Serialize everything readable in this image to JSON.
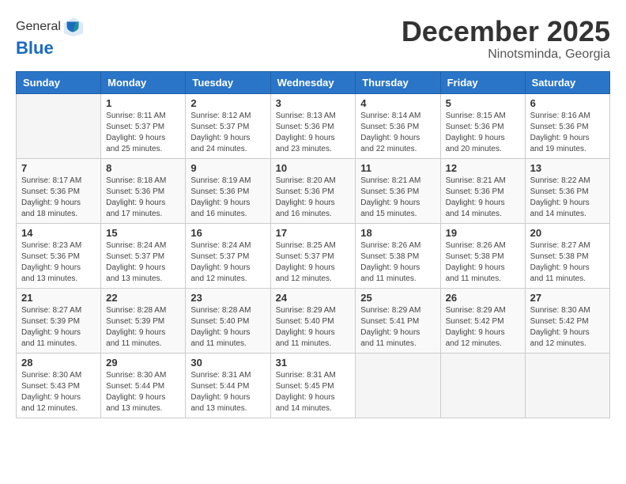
{
  "logo": {
    "general": "General",
    "blue": "Blue"
  },
  "header": {
    "month": "December 2025",
    "location": "Ninotsminda, Georgia"
  },
  "weekdays": [
    "Sunday",
    "Monday",
    "Tuesday",
    "Wednesday",
    "Thursday",
    "Friday",
    "Saturday"
  ],
  "weeks": [
    [
      {
        "day": "",
        "info": ""
      },
      {
        "day": "1",
        "info": "Sunrise: 8:11 AM\nSunset: 5:37 PM\nDaylight: 9 hours\nand 25 minutes."
      },
      {
        "day": "2",
        "info": "Sunrise: 8:12 AM\nSunset: 5:37 PM\nDaylight: 9 hours\nand 24 minutes."
      },
      {
        "day": "3",
        "info": "Sunrise: 8:13 AM\nSunset: 5:36 PM\nDaylight: 9 hours\nand 23 minutes."
      },
      {
        "day": "4",
        "info": "Sunrise: 8:14 AM\nSunset: 5:36 PM\nDaylight: 9 hours\nand 22 minutes."
      },
      {
        "day": "5",
        "info": "Sunrise: 8:15 AM\nSunset: 5:36 PM\nDaylight: 9 hours\nand 20 minutes."
      },
      {
        "day": "6",
        "info": "Sunrise: 8:16 AM\nSunset: 5:36 PM\nDaylight: 9 hours\nand 19 minutes."
      }
    ],
    [
      {
        "day": "7",
        "info": "Sunrise: 8:17 AM\nSunset: 5:36 PM\nDaylight: 9 hours\nand 18 minutes."
      },
      {
        "day": "8",
        "info": "Sunrise: 8:18 AM\nSunset: 5:36 PM\nDaylight: 9 hours\nand 17 minutes."
      },
      {
        "day": "9",
        "info": "Sunrise: 8:19 AM\nSunset: 5:36 PM\nDaylight: 9 hours\nand 16 minutes."
      },
      {
        "day": "10",
        "info": "Sunrise: 8:20 AM\nSunset: 5:36 PM\nDaylight: 9 hours\nand 16 minutes."
      },
      {
        "day": "11",
        "info": "Sunrise: 8:21 AM\nSunset: 5:36 PM\nDaylight: 9 hours\nand 15 minutes."
      },
      {
        "day": "12",
        "info": "Sunrise: 8:21 AM\nSunset: 5:36 PM\nDaylight: 9 hours\nand 14 minutes."
      },
      {
        "day": "13",
        "info": "Sunrise: 8:22 AM\nSunset: 5:36 PM\nDaylight: 9 hours\nand 14 minutes."
      }
    ],
    [
      {
        "day": "14",
        "info": "Sunrise: 8:23 AM\nSunset: 5:36 PM\nDaylight: 9 hours\nand 13 minutes."
      },
      {
        "day": "15",
        "info": "Sunrise: 8:24 AM\nSunset: 5:37 PM\nDaylight: 9 hours\nand 13 minutes."
      },
      {
        "day": "16",
        "info": "Sunrise: 8:24 AM\nSunset: 5:37 PM\nDaylight: 9 hours\nand 12 minutes."
      },
      {
        "day": "17",
        "info": "Sunrise: 8:25 AM\nSunset: 5:37 PM\nDaylight: 9 hours\nand 12 minutes."
      },
      {
        "day": "18",
        "info": "Sunrise: 8:26 AM\nSunset: 5:38 PM\nDaylight: 9 hours\nand 11 minutes."
      },
      {
        "day": "19",
        "info": "Sunrise: 8:26 AM\nSunset: 5:38 PM\nDaylight: 9 hours\nand 11 minutes."
      },
      {
        "day": "20",
        "info": "Sunrise: 8:27 AM\nSunset: 5:38 PM\nDaylight: 9 hours\nand 11 minutes."
      }
    ],
    [
      {
        "day": "21",
        "info": "Sunrise: 8:27 AM\nSunset: 5:39 PM\nDaylight: 9 hours\nand 11 minutes."
      },
      {
        "day": "22",
        "info": "Sunrise: 8:28 AM\nSunset: 5:39 PM\nDaylight: 9 hours\nand 11 minutes."
      },
      {
        "day": "23",
        "info": "Sunrise: 8:28 AM\nSunset: 5:40 PM\nDaylight: 9 hours\nand 11 minutes."
      },
      {
        "day": "24",
        "info": "Sunrise: 8:29 AM\nSunset: 5:40 PM\nDaylight: 9 hours\nand 11 minutes."
      },
      {
        "day": "25",
        "info": "Sunrise: 8:29 AM\nSunset: 5:41 PM\nDaylight: 9 hours\nand 11 minutes."
      },
      {
        "day": "26",
        "info": "Sunrise: 8:29 AM\nSunset: 5:42 PM\nDaylight: 9 hours\nand 12 minutes."
      },
      {
        "day": "27",
        "info": "Sunrise: 8:30 AM\nSunset: 5:42 PM\nDaylight: 9 hours\nand 12 minutes."
      }
    ],
    [
      {
        "day": "28",
        "info": "Sunrise: 8:30 AM\nSunset: 5:43 PM\nDaylight: 9 hours\nand 12 minutes."
      },
      {
        "day": "29",
        "info": "Sunrise: 8:30 AM\nSunset: 5:44 PM\nDaylight: 9 hours\nand 13 minutes."
      },
      {
        "day": "30",
        "info": "Sunrise: 8:31 AM\nSunset: 5:44 PM\nDaylight: 9 hours\nand 13 minutes."
      },
      {
        "day": "31",
        "info": "Sunrise: 8:31 AM\nSunset: 5:45 PM\nDaylight: 9 hours\nand 14 minutes."
      },
      {
        "day": "",
        "info": ""
      },
      {
        "day": "",
        "info": ""
      },
      {
        "day": "",
        "info": ""
      }
    ]
  ]
}
